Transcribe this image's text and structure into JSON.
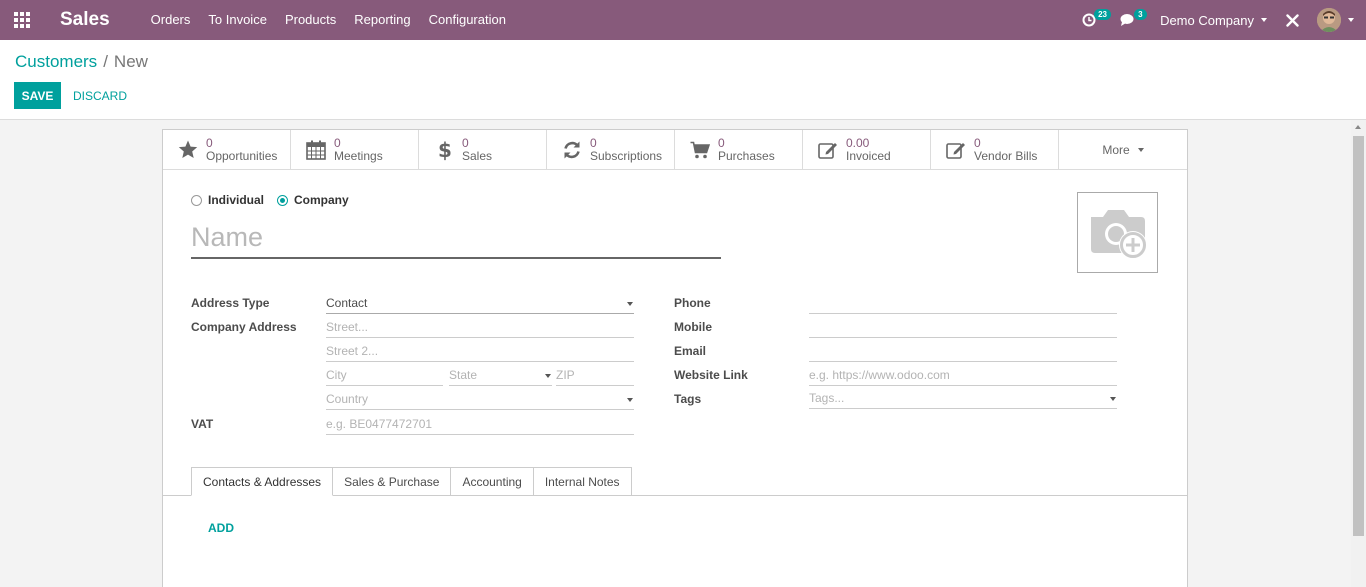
{
  "navbar": {
    "brand": "Sales",
    "menu": [
      "Orders",
      "To Invoice",
      "Products",
      "Reporting",
      "Configuration"
    ],
    "activity_count": "23",
    "message_count": "3",
    "company": "Demo Company"
  },
  "breadcrumb": {
    "parent": "Customers",
    "separator": "/",
    "current": "New"
  },
  "actions": {
    "save_label": "SAVE",
    "discard_label": "DISCARD"
  },
  "stat_buttons": [
    {
      "value": "0",
      "label": "Opportunities",
      "icon": "star-icon"
    },
    {
      "value": "0",
      "label": "Meetings",
      "icon": "calendar-icon"
    },
    {
      "value": "0",
      "label": "Sales",
      "icon": "dollar-icon"
    },
    {
      "value": "0",
      "label": "Subscriptions",
      "icon": "refresh-icon"
    },
    {
      "value": "0",
      "label": "Purchases",
      "icon": "cart-icon"
    },
    {
      "value": "0.00",
      "label": "Invoiced",
      "icon": "edit-icon"
    },
    {
      "value": "0",
      "label": "Vendor Bills",
      "icon": "edit-icon"
    }
  ],
  "more_label": "More",
  "company_type": {
    "options": [
      "Individual",
      "Company"
    ],
    "selected": "Company"
  },
  "name_placeholder": "Name",
  "left_fields": {
    "address_type_label": "Address Type",
    "address_type_value": "Contact",
    "company_address_label": "Company Address",
    "street_placeholder": "Street...",
    "street2_placeholder": "Street 2...",
    "city_placeholder": "City",
    "state_placeholder": "State",
    "zip_placeholder": "ZIP",
    "country_placeholder": "Country",
    "vat_label": "VAT",
    "vat_placeholder": "e.g. BE0477472701"
  },
  "right_fields": {
    "phone_label": "Phone",
    "mobile_label": "Mobile",
    "email_label": "Email",
    "website_label": "Website Link",
    "website_placeholder": "e.g. https://www.odoo.com",
    "tags_label": "Tags",
    "tags_placeholder": "Tags..."
  },
  "tabs": [
    "Contacts & Addresses",
    "Sales & Purchase",
    "Accounting",
    "Internal Notes"
  ],
  "active_tab": "Contacts & Addresses",
  "add_label": "ADD",
  "colors": {
    "navbar": "#875a7b",
    "primary": "#00a09d"
  }
}
